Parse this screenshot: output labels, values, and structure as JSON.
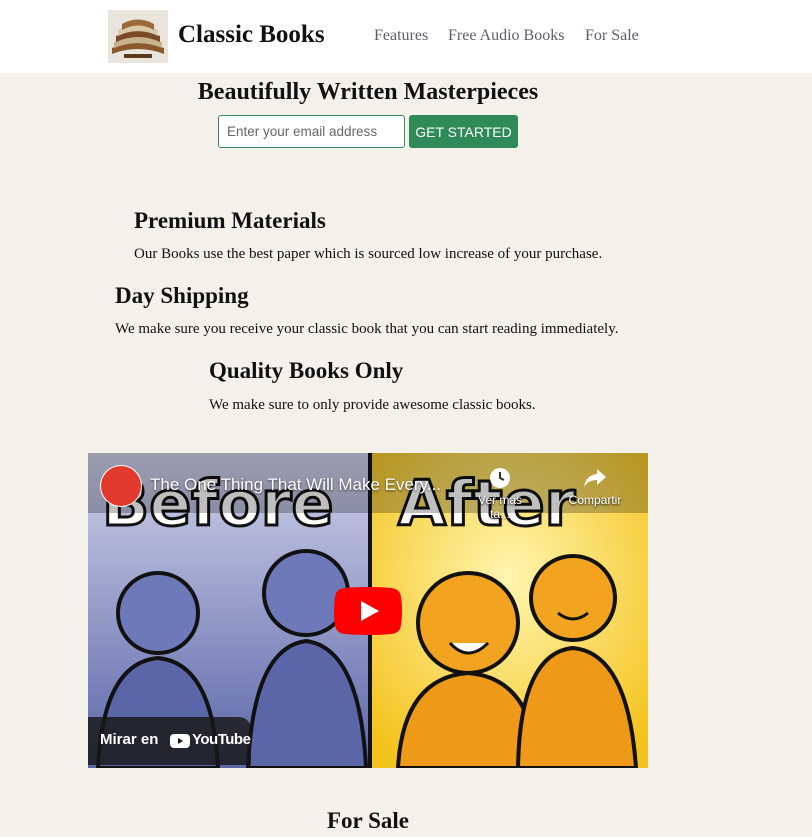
{
  "header": {
    "brand": "Classic Books",
    "nav": [
      "Features",
      "Free Audio Books",
      "For Sale"
    ]
  },
  "hero": {
    "title": "Beautifully Written Masterpieces",
    "email_placeholder": "Enter your email address",
    "cta_label": "GET STARTED"
  },
  "features": [
    {
      "title": "Premium Materials",
      "text": "Our Books use the best paper which is sourced low increase of your purchase."
    },
    {
      "title": "Day Shipping",
      "text": "We make sure you receive your classic book that you can start reading immediately."
    },
    {
      "title": "Quality Books Only",
      "text": "We make sure to only provide awesome classic books."
    }
  ],
  "video": {
    "title": "The One Thing That Will Make Every...",
    "watch_later": "Ver más ta...",
    "share": "Compartir",
    "watch_on": "Mirar en",
    "youtube": "YouTube",
    "thumb_left_text": "Before",
    "thumb_right_text": "After"
  },
  "sale": {
    "title": "For Sale"
  },
  "colors": {
    "background": "#f4f1ea",
    "accent": "#2e8b57",
    "nav_text": "#5d5d6b",
    "youtube_red": "#ff0000"
  }
}
